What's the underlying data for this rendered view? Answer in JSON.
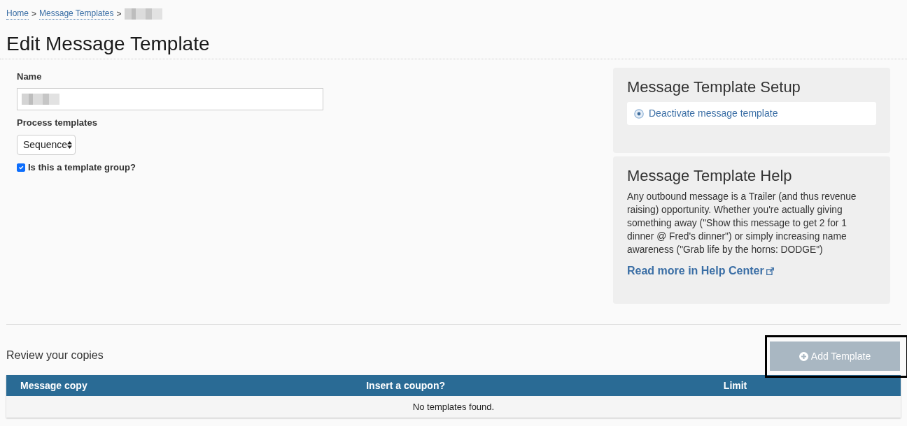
{
  "breadcrumb": [
    {
      "label": "Home",
      "separator": ">"
    },
    {
      "label": "Message Templates",
      "separator": ">"
    },
    {
      "redacted": true
    }
  ],
  "title": "Edit Message Template",
  "form": {
    "name": {
      "label": "Name",
      "redacted": true
    },
    "process_templates": {
      "label": "Process templates",
      "value": "Sequence"
    },
    "template_group": {
      "label": "Is this a template group?",
      "checked": true
    }
  },
  "setup_panel": {
    "title": "Message Template Setup",
    "actions": [
      {
        "label": "Deactivate message template"
      }
    ]
  },
  "help_panel": {
    "title": "Message Template Help",
    "text": "Any outbound message is a Trailer (and thus revenue raising) opportunity. Whether you're actually giving something away (\"Show this message to get 2 for 1 dinner @ Fred's dinner\") or simply increasing name awareness (\"Grab life by the horns: DODGE\")",
    "link": "Read more in Help Center"
  },
  "review": {
    "title": "Review your copies",
    "add_button": {
      "label": "Add Template",
      "highlighted": true
    }
  },
  "table": {
    "columns": [
      "Message copy",
      "Insert a coupon?",
      "Limit"
    ],
    "empty_text": "No templates found."
  }
}
